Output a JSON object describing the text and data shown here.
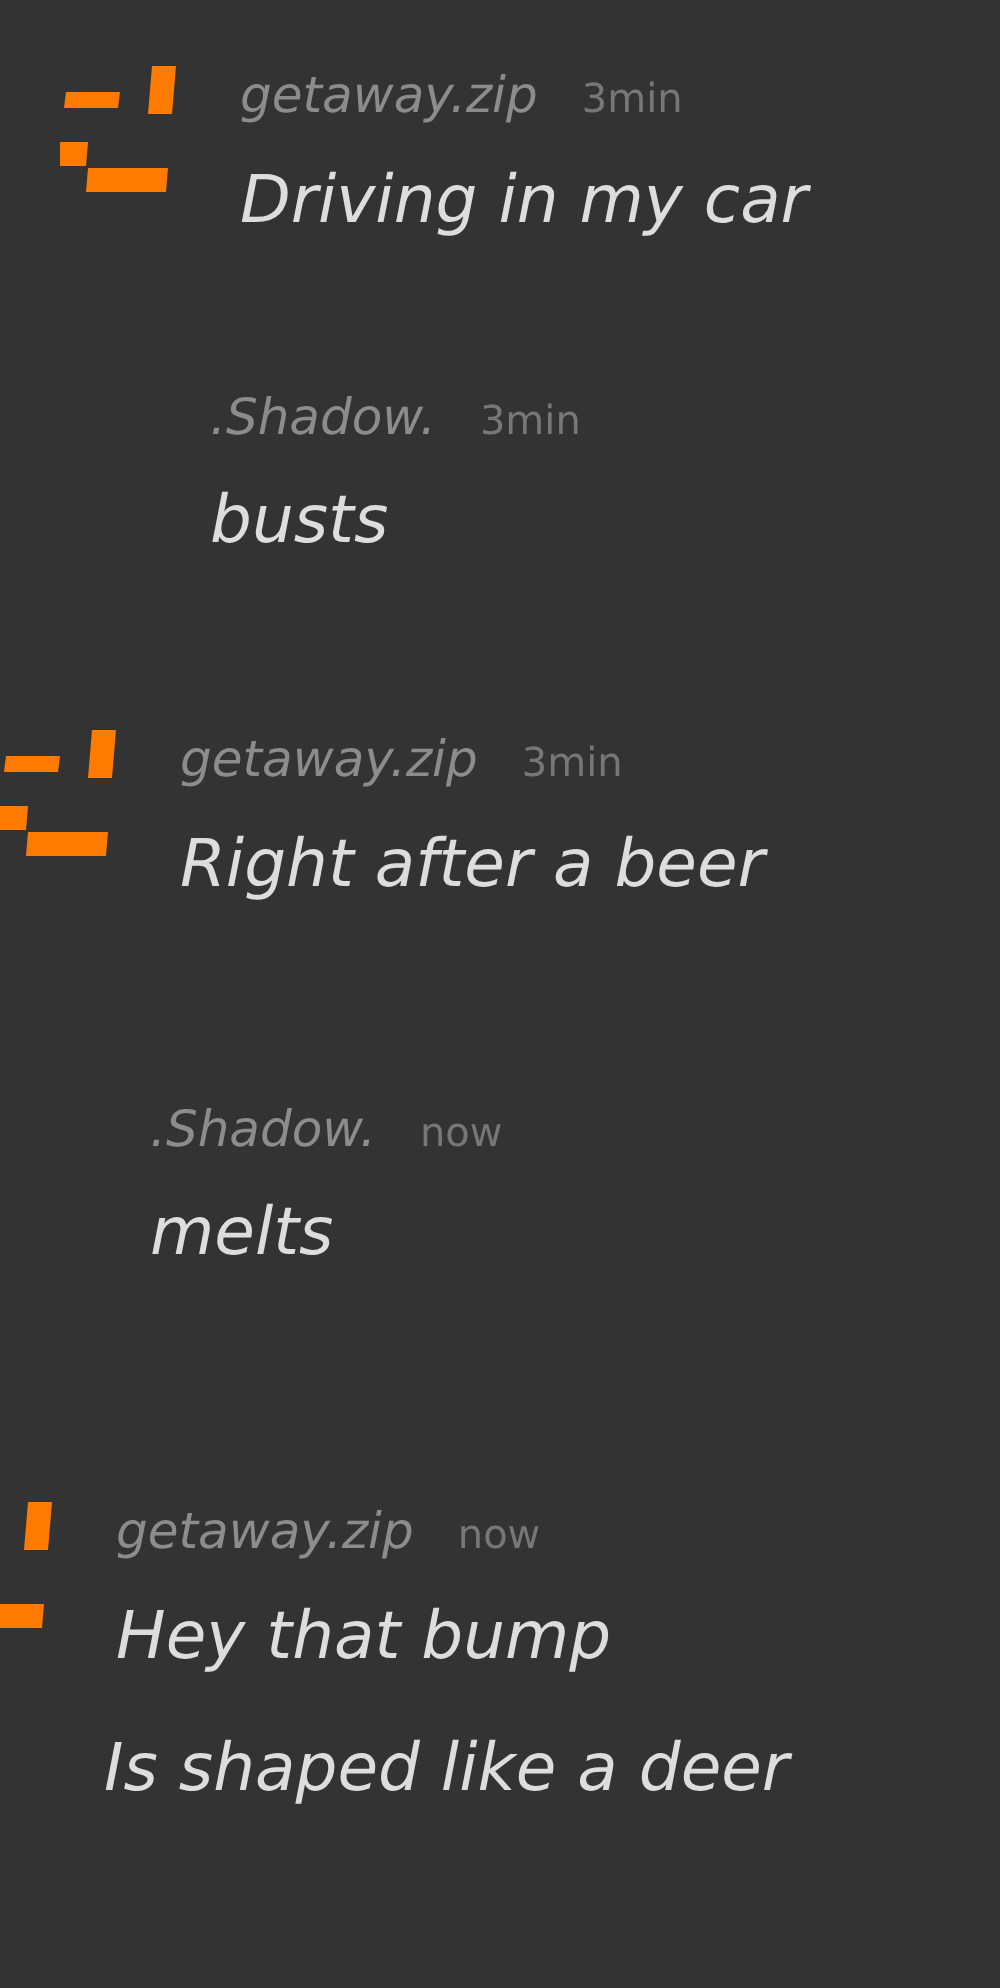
{
  "messages": [
    {
      "author": "getaway.zip",
      "time": "3min",
      "avatar": true,
      "lines": [
        "Driving in my car"
      ]
    },
    {
      "author": ".Shadow.",
      "time": "3min",
      "avatar": false,
      "lines": [
        "busts"
      ]
    },
    {
      "author": "getaway.zip",
      "time": "3min",
      "avatar": true,
      "lines": [
        "Right after a beer"
      ]
    },
    {
      "author": ".Shadow.",
      "time": "now",
      "avatar": false,
      "lines": [
        "melts"
      ]
    },
    {
      "author": "getaway.zip",
      "time": "now",
      "avatar": true,
      "lines": [
        "Hey that bump",
        "Is shaped like a deer"
      ]
    }
  ]
}
